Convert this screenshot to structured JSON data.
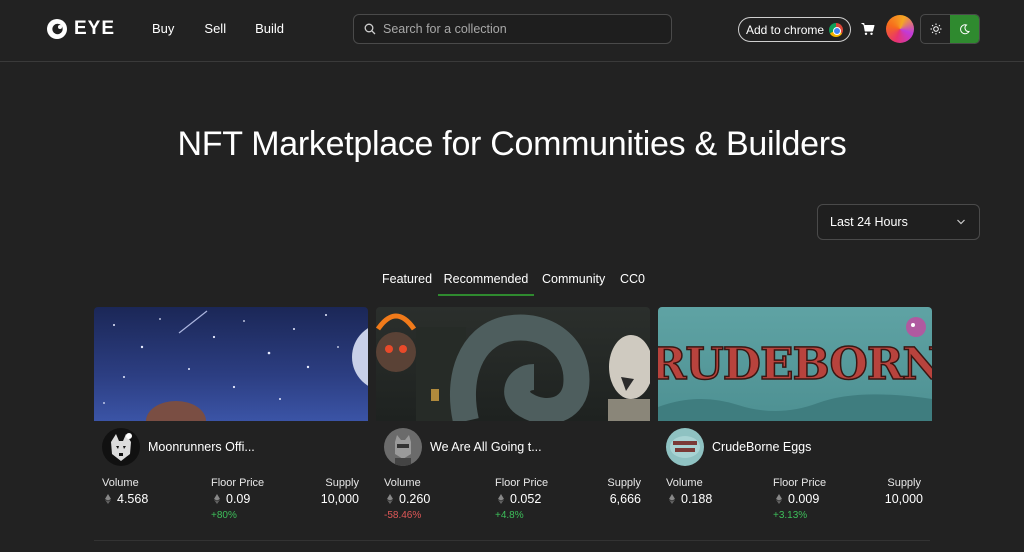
{
  "header": {
    "logo_text": "EYE",
    "nav": [
      "Buy",
      "Sell",
      "Build"
    ],
    "search_placeholder": "Search for a collection",
    "add_to_chrome": "Add to chrome",
    "accent_color": "#2f8a2f"
  },
  "hero": {
    "title": "NFT Marketplace for Communities & Builders"
  },
  "filters": {
    "time_range": "Last 24 Hours"
  },
  "tabs": [
    {
      "label": "Featured",
      "active": false
    },
    {
      "label": "Recommended",
      "active": true
    },
    {
      "label": "Community",
      "active": false
    },
    {
      "label": "CC0",
      "active": false
    }
  ],
  "collections": [
    {
      "name": "Moonrunners Offi...",
      "volume_label": "Volume",
      "volume": "4.568",
      "volume_change": "",
      "floor_label": "Floor Price",
      "floor": "0.09",
      "floor_change": "+80%",
      "supply_label": "Supply",
      "supply": "10,000"
    },
    {
      "name": "We Are All Going t...",
      "volume_label": "Volume",
      "volume": "0.260",
      "volume_change": "-58.46%",
      "floor_label": "Floor Price",
      "floor": "0.052",
      "floor_change": "+4.8%",
      "supply_label": "Supply",
      "supply": "6,666"
    },
    {
      "name": "CrudeBorne Eggs",
      "banner_text": "CRUDEBORNE",
      "volume_label": "Volume",
      "volume": "0.188",
      "volume_change": "",
      "floor_label": "Floor Price",
      "floor": "0.009",
      "floor_change": "+3.13%",
      "supply_label": "Supply",
      "supply": "10,000"
    }
  ],
  "colors": {
    "background": "#222222",
    "positive": "#3dbf5a",
    "negative": "#e05858"
  }
}
